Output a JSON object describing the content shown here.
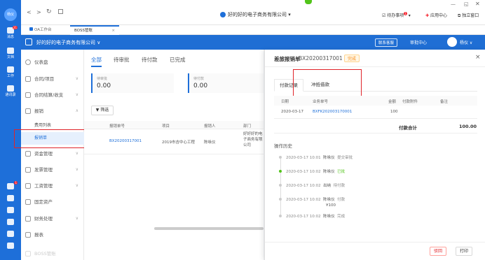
{
  "rail": {
    "avatar": "杨仪",
    "items": [
      {
        "label": "消息",
        "badge": "31"
      },
      {
        "label": "文档",
        "badge": ""
      },
      {
        "label": "工作",
        "badge": ""
      },
      {
        "label": "通讯录",
        "badge": ""
      }
    ],
    "bottom_badge": "1"
  },
  "topbar": {
    "company": "好的好的电子商务有限公司",
    "todo": "待办事项",
    "todo_badge": "1",
    "app_center": "应用中心",
    "standalone": "独立窗口"
  },
  "tabs": [
    {
      "label": "OA工作台"
    },
    {
      "label": "BOSS管账"
    }
  ],
  "header": {
    "company": "好的好的电子商务有限公司",
    "contact": "联系客服",
    "approval_center": "审批中心",
    "user": "杨仪"
  },
  "menu": {
    "items": [
      {
        "label": "仪表盘",
        "icon": "dashboard-icon",
        "chev": ""
      },
      {
        "label": "合同/项目",
        "icon": "contract-icon",
        "chev": "∨"
      },
      {
        "label": "合同结算/收支",
        "icon": "settlement-icon",
        "chev": "∨"
      },
      {
        "label": "报销",
        "icon": "reimburse-icon",
        "chev": "∧"
      },
      {
        "label": "费用列表",
        "icon": "",
        "chev": ""
      },
      {
        "label": "报销单",
        "icon": "",
        "chev": ""
      },
      {
        "label": "资金管理",
        "icon": "fund-icon",
        "chev": "∨"
      },
      {
        "label": "发票管理",
        "icon": "invoice-icon",
        "chev": "∨"
      },
      {
        "label": "工资管理",
        "icon": "salary-icon",
        "chev": "∨"
      },
      {
        "label": "固定资产",
        "icon": "asset-icon",
        "chev": ""
      },
      {
        "label": "财务处理",
        "icon": "finance-icon",
        "chev": "∨"
      },
      {
        "label": "报表",
        "icon": "report-icon",
        "chev": ""
      }
    ],
    "footer": "BOSS管账"
  },
  "main": {
    "tabs": [
      "全部",
      "待审批",
      "待付款",
      "已完成"
    ],
    "cards": [
      {
        "label": "待审批",
        "value": "0.00"
      },
      {
        "label": "待付款",
        "value": "0.00"
      }
    ],
    "filter": "筛选",
    "columns": [
      "报销单号",
      "项目",
      "报销人",
      "部门"
    ],
    "rows": [
      {
        "no": "BX20200317001",
        "project": "2019市吉中心工程",
        "person": "陈咏仪",
        "dept": "好好好的电子商务有限公司"
      }
    ]
  },
  "drawer": {
    "title": "差旅报销单",
    "doc_no": "BX20200317001",
    "status": "完成",
    "tabs": [
      "付款记录",
      "冲抵借款"
    ],
    "table_columns": [
      "日期",
      "业务单号",
      "金额",
      "付款附件",
      "备注"
    ],
    "table_rows": [
      {
        "date": "2020-03-17",
        "biz_no": "BXFK202003170001",
        "amount": "100",
        "attachment": "",
        "note": ""
      }
    ],
    "total_label": "付款合计",
    "total_value": "100.00",
    "history_title": "操作历史",
    "history": [
      {
        "time": "2020-03-17 10:01",
        "person": "陈咏仪",
        "action": "提交审批",
        "extra": ""
      },
      {
        "time": "2020-03-17 10:02",
        "person": "陈咏仪",
        "action": "已批",
        "extra": ""
      },
      {
        "time": "2020-03-17 10:02",
        "person": "出纳",
        "action": "待付款",
        "extra": ""
      },
      {
        "time": "2020-03-17 10:02",
        "person": "陈咏仪",
        "action": "付款",
        "extra": "¥100"
      },
      {
        "time": "2020-03-17 10:02",
        "person": "陈咏仪",
        "action": "完成",
        "extra": ""
      }
    ],
    "reject": "驳回",
    "print": "打印"
  },
  "colors": {
    "brand": "#1e6fd9",
    "status_done": "#fa8c16",
    "highlight": "#e0242a",
    "approved": "#52c41a"
  }
}
